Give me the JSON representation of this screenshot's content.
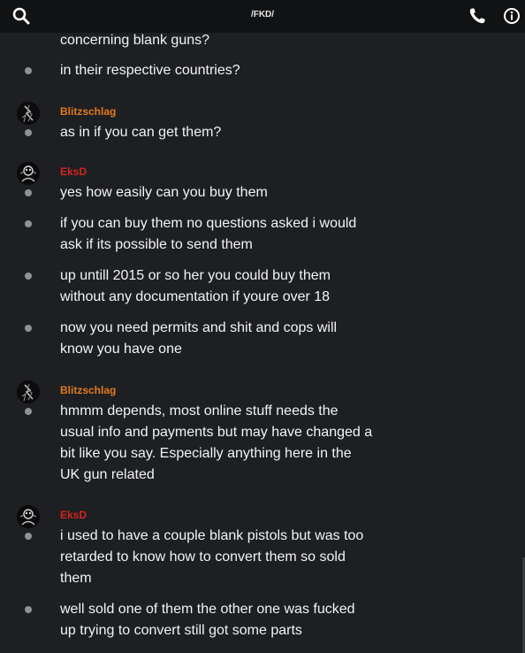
{
  "header": {
    "title": "/FKD/"
  },
  "icons": {
    "search": "search-icon",
    "phone": "phone-icon",
    "info": "info-icon"
  },
  "colors": {
    "background": "#1e1f22",
    "topbar": "#111214",
    "username_blitzschlag": "#e07a1f",
    "username_eksd": "#d0261d",
    "bullet": "#8e9297",
    "text": "#f2f3f5"
  },
  "messages": [
    {
      "lines": [
        "concerning blank guns?"
      ]
    },
    {
      "lines": [
        "in their respective countries?"
      ]
    },
    {
      "author": "Blitzschlag",
      "lines": [
        "as in if you can get them?"
      ]
    },
    {
      "author": "EksD",
      "lines": [
        "yes how easily can you buy them"
      ]
    },
    {
      "lines": [
        "if you can buy them no questions asked i would",
        "ask if its possible to send them"
      ]
    },
    {
      "lines": [
        "up untill 2015 or so her you could buy them",
        "without any documentation if youre over 18"
      ]
    },
    {
      "lines": [
        "now you need permits and shit and cops will",
        "know you have one"
      ]
    },
    {
      "author": "Blitzschlag",
      "lines": [
        "hmmm depends, most online stuff needs the",
        "usual info and payments but may have changed a",
        "bit like you say.  Especially anything here in the",
        "UK gun related"
      ]
    },
    {
      "author": "EksD",
      "lines": [
        "i used to have a couple blank pistols but was too",
        "retarded to know how to convert them so sold",
        "them"
      ]
    },
    {
      "lines": [
        "well sold one of them the other one was fucked",
        "up trying to convert still got some parts"
      ]
    }
  ]
}
